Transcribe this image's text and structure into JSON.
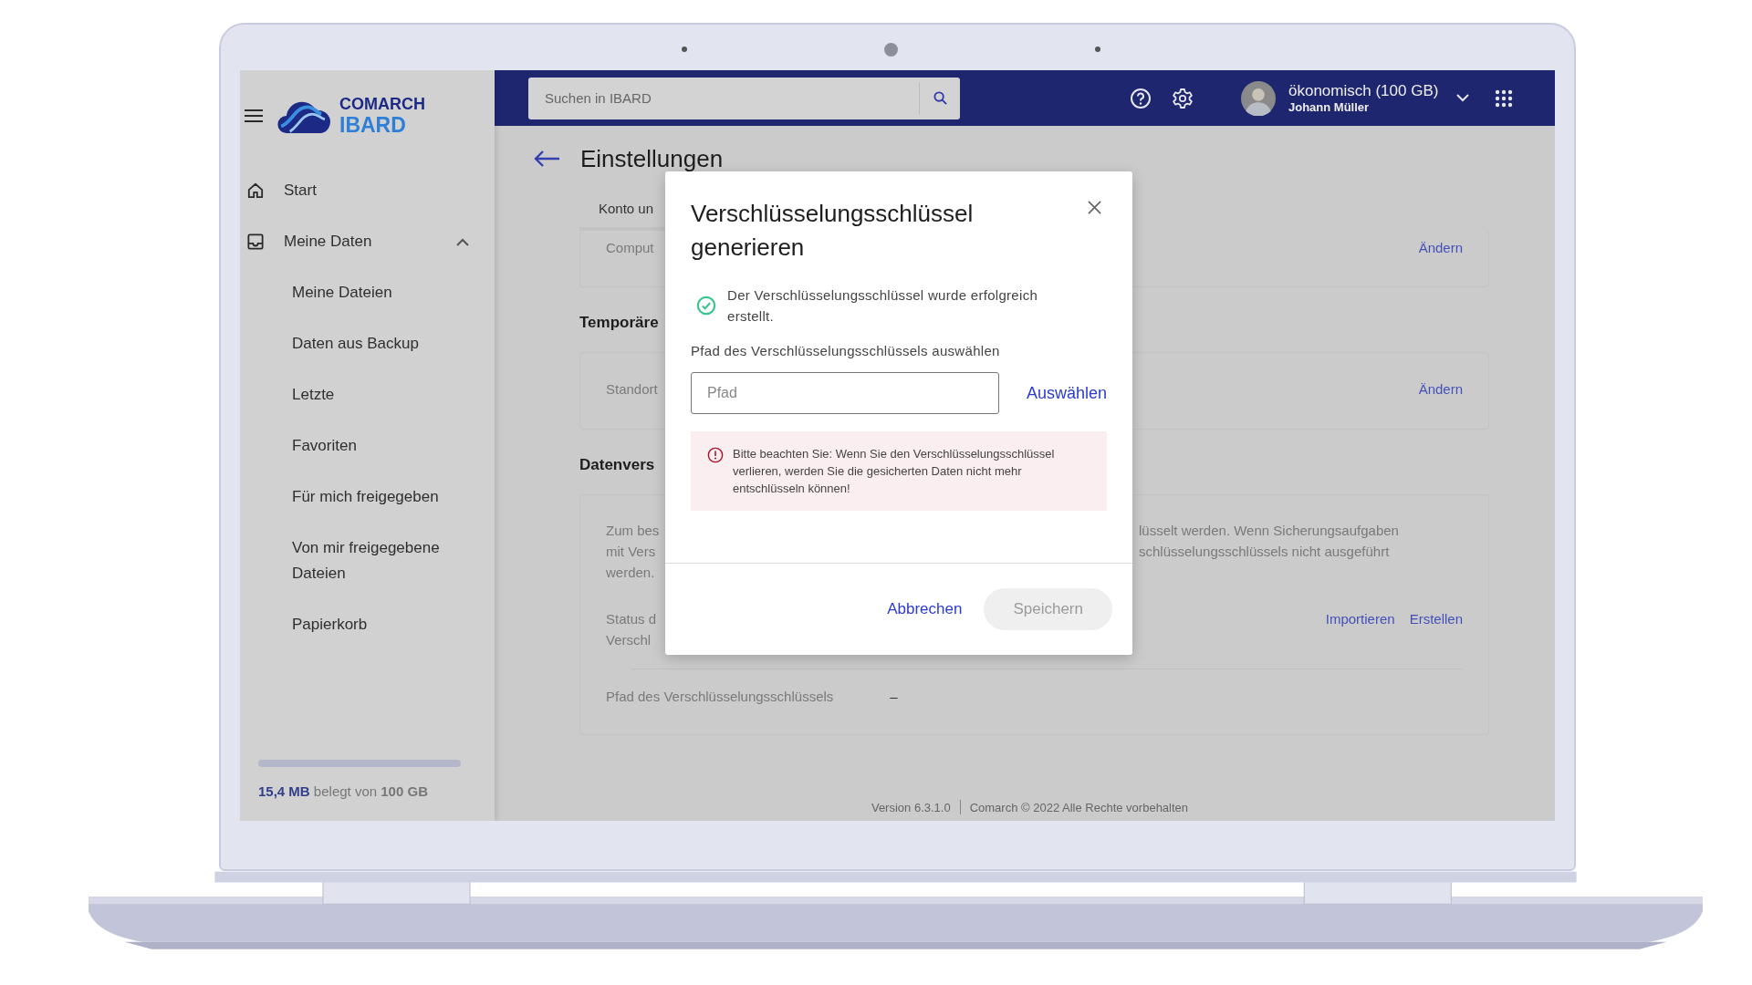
{
  "sidebar": {
    "logo": {
      "line1": "COMARCH",
      "line2": "IBARD"
    },
    "nav": [
      {
        "kind": "home",
        "label": "Start"
      },
      {
        "kind": "inbox",
        "label": "Meine Daten",
        "expanded": true,
        "children": [
          {
            "label": "Meine Dateien"
          },
          {
            "label": "Daten aus Backup"
          },
          {
            "label": "Letzte"
          },
          {
            "label": "Favoriten"
          },
          {
            "label": "Für mich freigegeben"
          },
          {
            "label": "Von mir freigegebene Dateien"
          },
          {
            "label": "Papierkorb"
          }
        ]
      }
    ],
    "storage": {
      "text": "**15,4 MB** belegt von **100 GB**"
    }
  },
  "topbar": {
    "search": {
      "placeholder": "Suchen in IBARD"
    },
    "plan": "ökonomisch (100 GB)",
    "user": "Johann Müller"
  },
  "page": {
    "title": "Einstellungen",
    "tab": "Konto un",
    "account_card": {
      "label": "Comput",
      "action": "Ändern"
    },
    "sections": [
      {
        "heading": "Temporäre",
        "rows": [
          {
            "kind": "setting",
            "label_lines": [
              "Standort"
            ],
            "actions": [
              "Ändern"
            ]
          }
        ]
      },
      {
        "heading": "Datenvers",
        "rows": [
          {
            "kind": "description",
            "left_lines": [
              "Zum bes",
              "mit Vers",
              "werden."
            ],
            "right_lines": [
              "lüsselt werden. Wenn Sicherungsaufgaben",
              "schlüsselungsschlüssels nicht ausgeführt"
            ]
          },
          {
            "kind": "setting",
            "label_lines": [
              "Status d",
              "Verschl"
            ],
            "actions": [
              "Importieren",
              "Erstellen"
            ]
          },
          {
            "kind": "path",
            "label": "Pfad des Verschlüsselungsschlüssels",
            "value": "–"
          }
        ]
      }
    ]
  },
  "dialog": {
    "title": "Verschlüsselungsschlüssel generieren",
    "success": "Der Verschlüsselungsschlüssel wurde erfolgreich erstellt.",
    "field_label": "Pfad des Verschlüsselungsschlüssels auswählen",
    "path": {
      "placeholder": "Pfad"
    },
    "choose": "Auswählen",
    "warning": "Bitte beachten Sie: Wenn Sie den Verschlüsselungsschlüssel verlieren, werden Sie die gesicherten Daten nicht mehr entschlüsseln können!",
    "cancel": "Abbrechen",
    "save": {
      "label": "Speichern",
      "disabled": true
    }
  },
  "footer": {
    "version": "Version 6.3.1.0",
    "copyright": "Comarch © 2022 Alle Rechte vorbehalten"
  }
}
